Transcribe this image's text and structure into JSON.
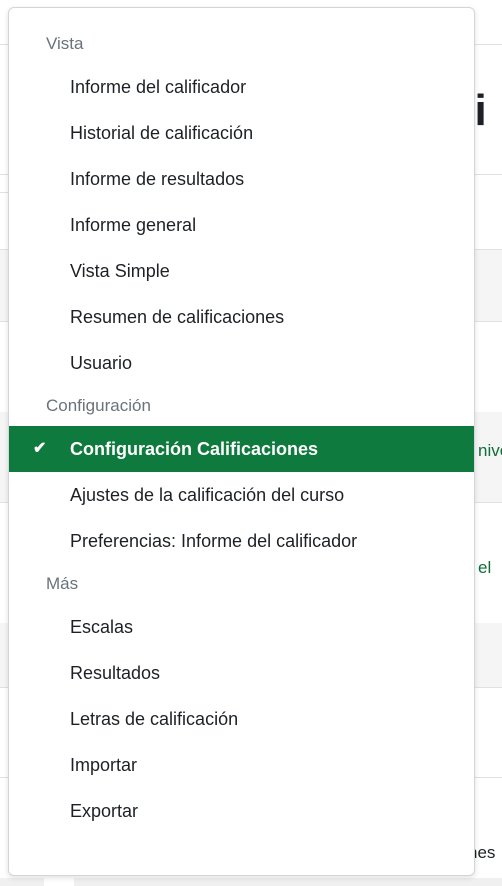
{
  "background": {
    "heading_fragment": "ci",
    "link_fragment_1": "nive",
    "link_fragment_2": "el",
    "text_fragment_bottom": "nes"
  },
  "menu": {
    "groups": [
      {
        "header": "Vista",
        "items": [
          {
            "label": "Informe del calificador",
            "active": false
          },
          {
            "label": "Historial de calificación",
            "active": false
          },
          {
            "label": "Informe de resultados",
            "active": false
          },
          {
            "label": "Informe general",
            "active": false
          },
          {
            "label": "Vista Simple",
            "active": false
          },
          {
            "label": "Resumen de calificaciones",
            "active": false
          },
          {
            "label": "Usuario",
            "active": false
          }
        ]
      },
      {
        "header": "Configuración",
        "items": [
          {
            "label": "Configuración Calificaciones",
            "active": true
          },
          {
            "label": "Ajustes de la calificación del curso",
            "active": false
          },
          {
            "label": "Preferencias: Informe del calificador",
            "active": false
          }
        ]
      },
      {
        "header": "Más",
        "items": [
          {
            "label": "Escalas",
            "active": false
          },
          {
            "label": "Resultados",
            "active": false
          },
          {
            "label": "Letras de calificación",
            "active": false
          },
          {
            "label": "Importar",
            "active": false
          },
          {
            "label": "Exportar",
            "active": false
          }
        ]
      }
    ],
    "active_icon": "check-icon",
    "colors": {
      "active_bg": "#0f7a3d",
      "active_text": "#ffffff",
      "header_text": "#6a737b",
      "item_text": "#1d2125"
    }
  }
}
